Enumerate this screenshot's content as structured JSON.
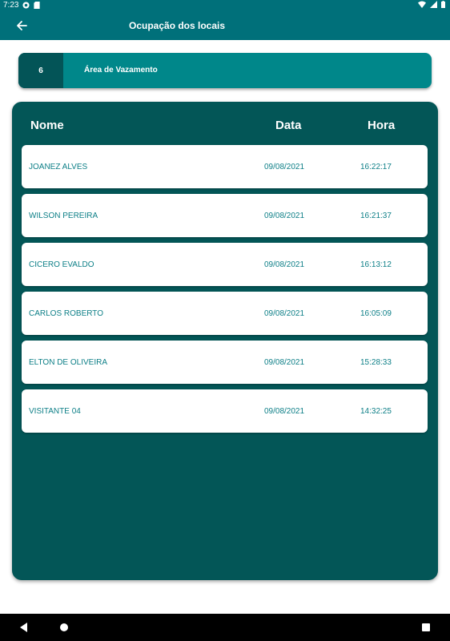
{
  "status": {
    "time": "7:23"
  },
  "app_bar": {
    "title": "Ocupação dos locais"
  },
  "location": {
    "number": "6",
    "name": "Área de Vazamento"
  },
  "table": {
    "headers": {
      "name": "Nome",
      "date": "Data",
      "time": "Hora"
    },
    "rows": [
      {
        "name": "JOANEZ ALVES",
        "date": "09/08/2021",
        "time": "16:22:17"
      },
      {
        "name": "WILSON PEREIRA",
        "date": "09/08/2021",
        "time": "16:21:37"
      },
      {
        "name": "CICERO EVALDO",
        "date": "09/08/2021",
        "time": "16:13:12"
      },
      {
        "name": "CARLOS ROBERTO",
        "date": "09/08/2021",
        "time": "16:05:09"
      },
      {
        "name": "ELTON DE OLIVEIRA",
        "date": "09/08/2021",
        "time": "15:28:33"
      },
      {
        "name": "VISITANTE 04",
        "date": "09/08/2021",
        "time": "14:32:25"
      }
    ]
  },
  "colors": {
    "primary": "#00707a",
    "panel": "#035657",
    "card": "#00878a",
    "row_text": "#0d7f87"
  }
}
